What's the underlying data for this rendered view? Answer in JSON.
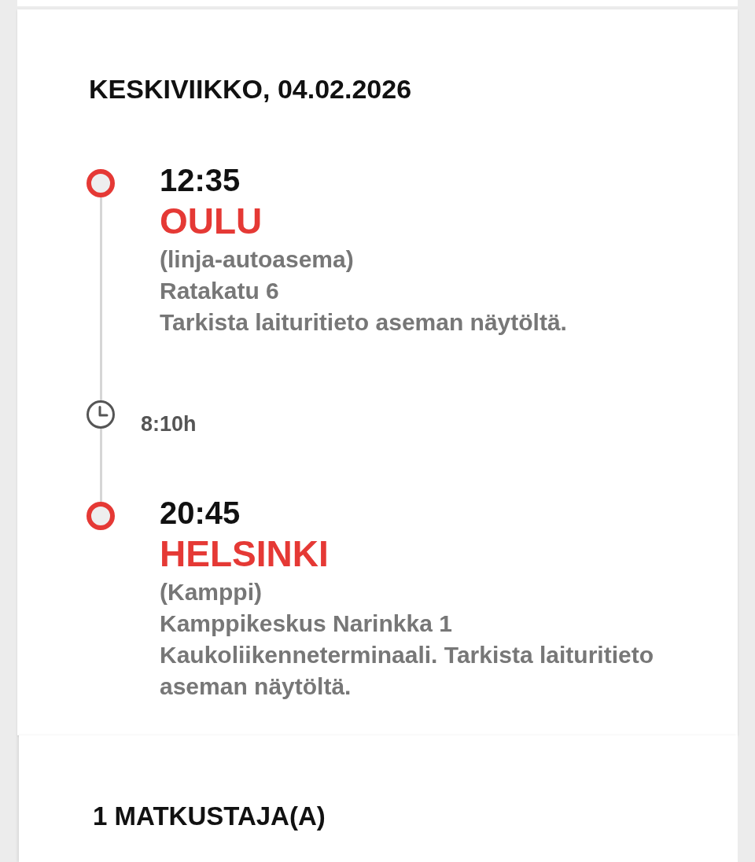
{
  "journey": {
    "date": "KESKIVIIKKO, 04.02.2026",
    "timeline": [
      {
        "kind": "stop",
        "time": "12:35",
        "city": "OULU",
        "station": "(linja-autoasema)",
        "address": "Ratakatu 6",
        "note": "Tarkista laituritieto aseman näytöltä."
      },
      {
        "kind": "duration",
        "duration": "8:10h"
      },
      {
        "kind": "stop",
        "time": "20:45",
        "city": "HELSINKI",
        "station": "(Kamppi)",
        "address": "Kamppikeskus Narinkka 1",
        "note": "Kaukoliikenneterminaali. Tarkista laituritieto aseman näytöltä."
      }
    ]
  },
  "passengers": {
    "title": "1 MATKUSTAJA(A)"
  }
}
